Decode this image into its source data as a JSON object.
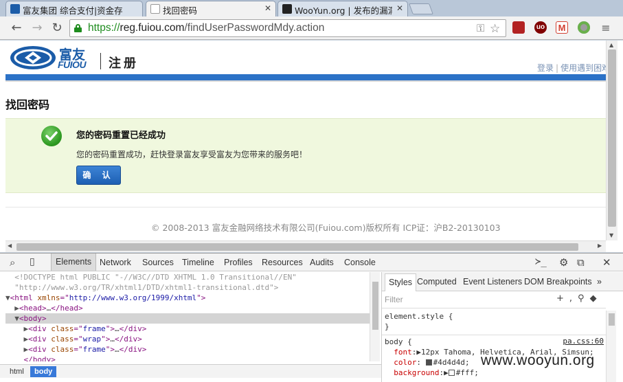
{
  "tabs": [
    {
      "title": "富友集团 综合支付|资金存",
      "active": false,
      "favicon_color": "#1b5ca8"
    },
    {
      "title": "找回密码",
      "active": true,
      "favicon_color": "#e8e8e8"
    },
    {
      "title": "WooYun.org | 发布的漏洞",
      "active": false,
      "favicon_color": "#222222"
    }
  ],
  "toolbar": {
    "url_scheme": "https://",
    "url_host": "reg.fuiou.com",
    "url_path": "/findUserPasswordMdy.action"
  },
  "page": {
    "logo_cn": "富友",
    "logo_en": "FUIOU",
    "register_title": "注册",
    "link_login": "登录",
    "link_help": "使用遇到困难",
    "heading": "找回密码",
    "success_title": "您的密码重置已经成功",
    "success_message": "您的密码重置成功，赶快登录富友享受富友为您带来的服务吧！",
    "confirm_button": "确 认",
    "copyright": "© 2008-2013 富友金融网络技术有限公司(Fuiou.com)版权所有  ICP证：沪B2-20130103"
  },
  "devtools": {
    "tabs": [
      "Elements",
      "Network",
      "Sources",
      "Timeline",
      "Profiles",
      "Resources",
      "Audits",
      "Console"
    ],
    "active_tab": "Elements",
    "breadcrumbs": [
      "html",
      "body"
    ],
    "styles_tabs": [
      "Styles",
      "Computed",
      "Event Listeners",
      "DOM Breakpoints"
    ],
    "filter_placeholder": "Filter",
    "element_style_selector": "element.style {",
    "element_style_close": "}",
    "body_selector": "body {",
    "body_source": "pa.css:60",
    "body_font": "12px Tahoma, Helvetica, Arial, Simsun;",
    "body_color": "#4d4d4d;",
    "body_background": "#fff;"
  },
  "watermark": "www.wooyun.org",
  "colors": {
    "accent_blue": "#2c72c7",
    "success_bg": "#f0f8de",
    "secure_green": "#1e8c1e"
  }
}
